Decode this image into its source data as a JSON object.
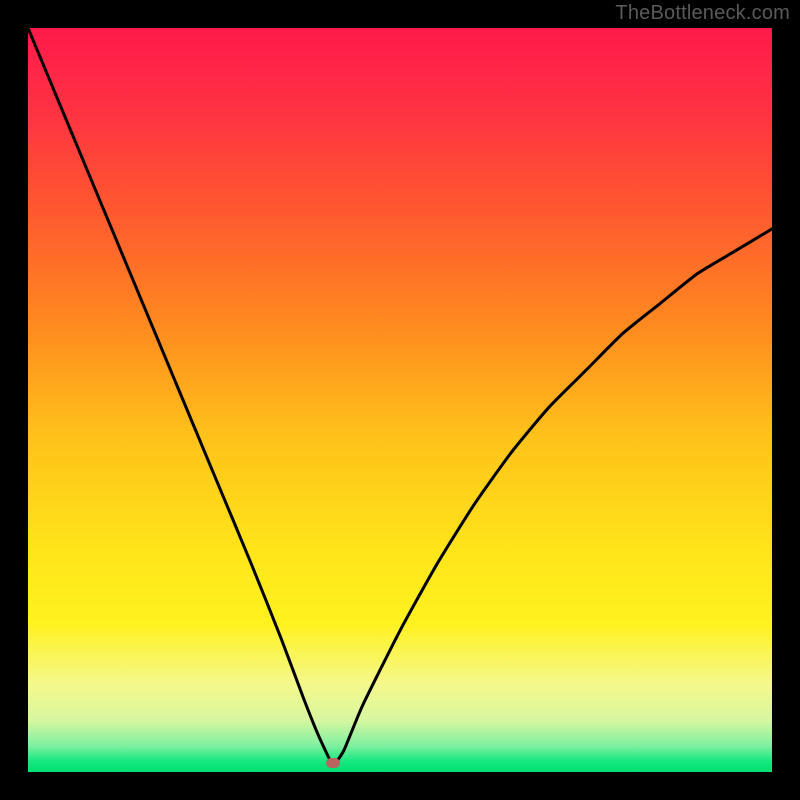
{
  "watermark": {
    "text": "TheBottleneck.com"
  },
  "chart_data": {
    "type": "line",
    "title": "",
    "xlabel": "",
    "ylabel": "",
    "xlim": [
      0,
      100
    ],
    "ylim": [
      0,
      100
    ],
    "gradient_background": {
      "stops": [
        {
          "offset": 0.0,
          "color": "#ff1a4b"
        },
        {
          "offset": 0.1,
          "color": "#ff2f44"
        },
        {
          "offset": 0.25,
          "color": "#ff5a2f"
        },
        {
          "offset": 0.4,
          "color": "#ff8a1f"
        },
        {
          "offset": 0.55,
          "color": "#ffc21a"
        },
        {
          "offset": 0.7,
          "color": "#ffe41a"
        },
        {
          "offset": 0.8,
          "color": "#fff21f"
        },
        {
          "offset": 0.88,
          "color": "#f5f88a"
        },
        {
          "offset": 0.93,
          "color": "#d8f7a0"
        },
        {
          "offset": 0.965,
          "color": "#7df0a0"
        },
        {
          "offset": 0.985,
          "color": "#18e880"
        },
        {
          "offset": 1.0,
          "color": "#00e070"
        }
      ]
    },
    "series": [
      {
        "name": "bottleneck-curve",
        "x": [
          0,
          5,
          10,
          15,
          20,
          25,
          30,
          34,
          37,
          39,
          40.8,
          41.3,
          42.5,
          45,
          50,
          55,
          60,
          65,
          70,
          75,
          80,
          85,
          90,
          95,
          100
        ],
        "y": [
          100,
          88,
          76,
          64,
          52,
          40,
          28,
          18,
          10,
          5,
          1.2,
          1.2,
          3.0,
          9,
          19,
          28,
          36,
          43,
          49,
          54,
          59,
          63,
          67,
          70,
          73
        ]
      }
    ],
    "marker": {
      "x": 41.0,
      "y": 1.2,
      "color": "#b9655f"
    },
    "annotations": []
  }
}
